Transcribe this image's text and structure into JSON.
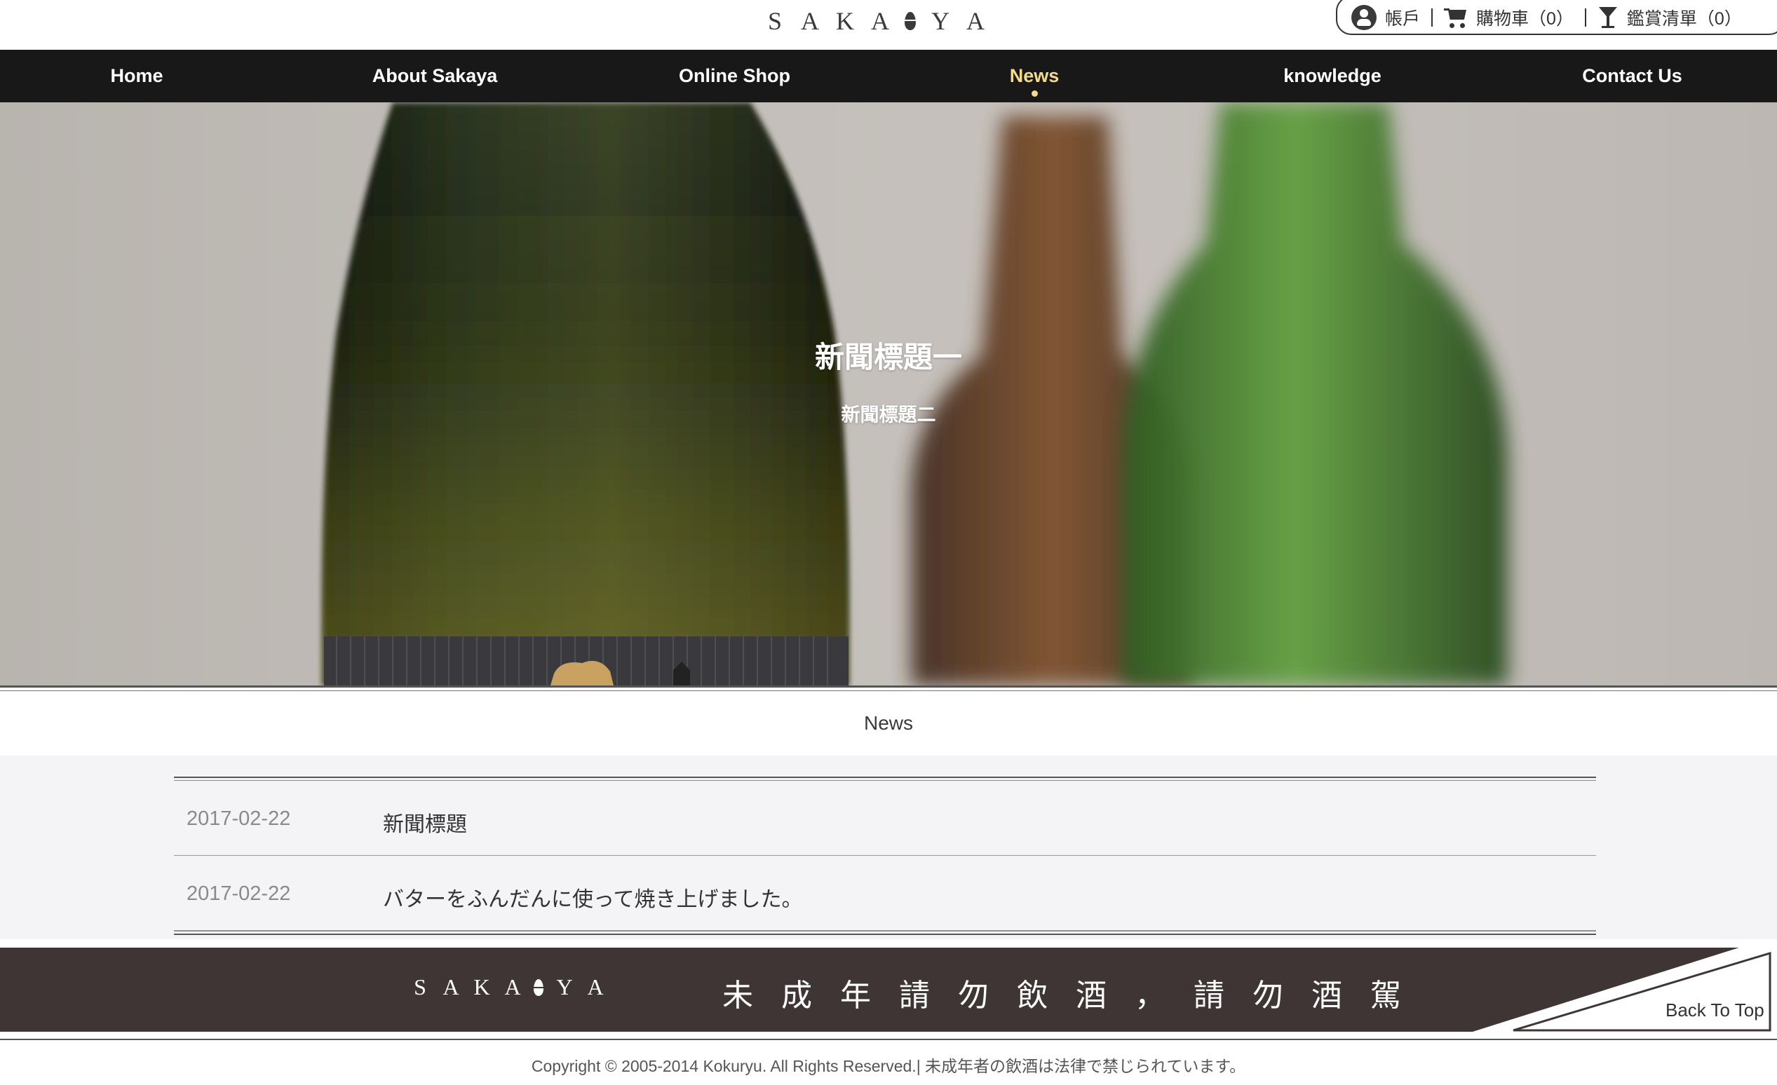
{
  "header": {
    "logo_letters": [
      "S",
      "A",
      "K",
      "A",
      "Y",
      "A"
    ],
    "account_label": "帳戶",
    "cart_label": "購物車（0）",
    "wishlist_label": "鑑賞清單（0）"
  },
  "nav": {
    "items": [
      {
        "label": "Home"
      },
      {
        "label": "About Sakaya"
      },
      {
        "label": "Online Shop"
      },
      {
        "label": "News",
        "active": true
      },
      {
        "label": "knowledge"
      },
      {
        "label": "Contact Us"
      }
    ]
  },
  "hero": {
    "title": "新聞標題一",
    "subtitle": "新聞標題二"
  },
  "section": {
    "title": "News"
  },
  "news": [
    {
      "date": "2017-02-22",
      "title": "新聞標題"
    },
    {
      "date": "2017-02-22",
      "title": "バターをふんだんに使って焼き上げました。"
    }
  ],
  "footer": {
    "slogan": "未成年請勿飲酒，請勿酒駕",
    "back_to_top": "Back To Top",
    "copyright": "Copyright © 2005-2014 Kokuryu. All Rights Reserved.| 未成年者の飲酒は法律で禁じられています。"
  },
  "colors": {
    "nav_bg": "#181818",
    "nav_active": "#f2dc8c",
    "footer_bg": "#3f3535"
  }
}
